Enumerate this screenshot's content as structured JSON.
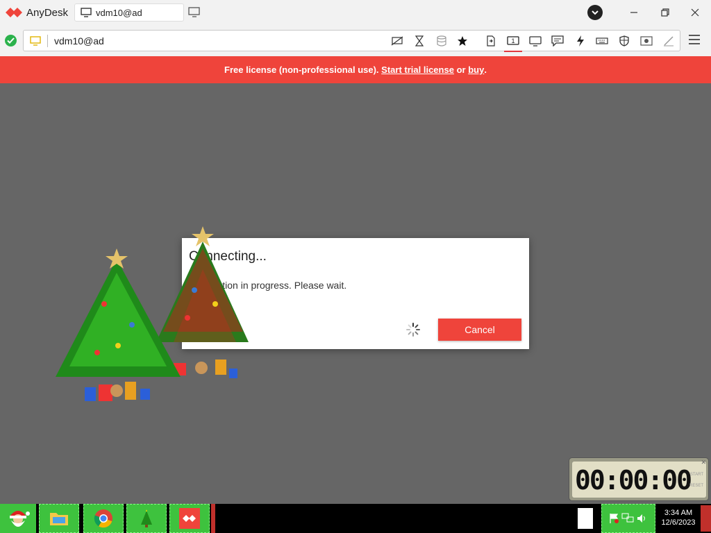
{
  "app": {
    "name": "AnyDesk",
    "accent": "#ef443b"
  },
  "tab": {
    "label": "vdm10@ad",
    "icon": "monitor-icon"
  },
  "address": {
    "value": "vdm10@ad",
    "status_icon": "check-circle-icon"
  },
  "banner": {
    "text_before": "Free license (non-professional use). ",
    "trial_link": "Start trial license",
    "middle": " or ",
    "buy_link": "buy",
    "end": "."
  },
  "dialog": {
    "title": "Connecting...",
    "message": "Connection in progress. Please wait.",
    "cancel_label": "Cancel"
  },
  "timer": {
    "display": "00:00:00",
    "label_start": "START",
    "label_reset": "RESET"
  },
  "taskbar": {
    "time": "3:34 AM",
    "date": "12/6/2023"
  }
}
